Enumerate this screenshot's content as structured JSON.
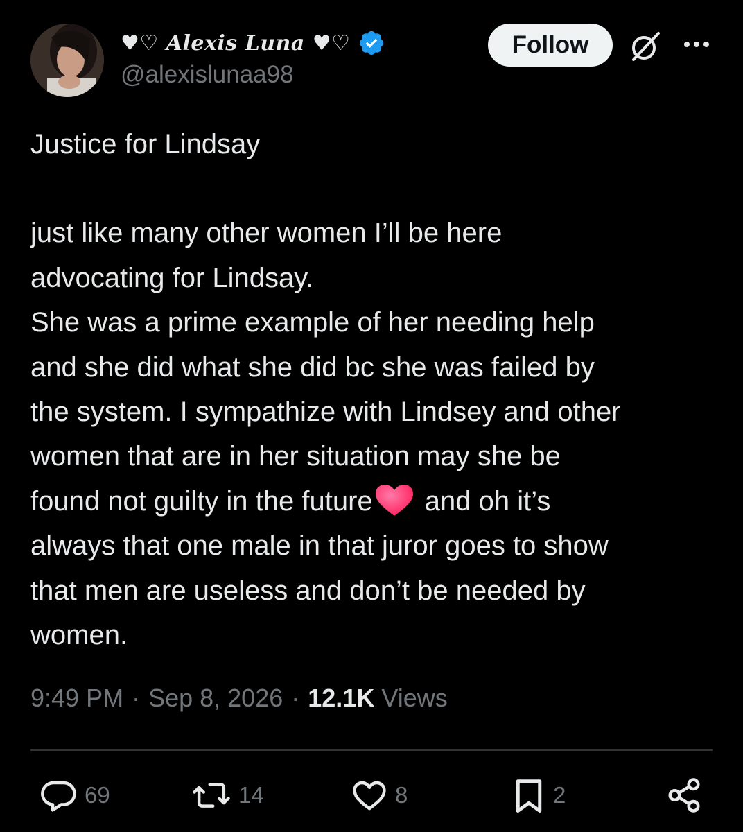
{
  "author": {
    "display_name": "♥♡ Alexis Luna ♥♡",
    "handle": "@alexislunaa98",
    "verified_icon": "verified-badge-icon",
    "verified_color": "#1d9bf0"
  },
  "header": {
    "follow_label": "Follow",
    "grok_icon": "grok-icon",
    "more_icon": "more-options-icon"
  },
  "tweet": {
    "title_line": "Justice for Lindsay",
    "lines": [
      "just like many other women I’ll be here",
      "advocating for Lindsay.",
      "She was a prime example of her needing help",
      "and she did what she did bc she  was failed by",
      "the system. I sympathize with Lindsey and other",
      "women that are in her situation may she be"
    ],
    "line_with_emoji_before": "found not guilty in the future",
    "emoji": "❤️",
    "line_with_emoji_after": " and oh it’s",
    "lines_after": [
      "always that one male in that juror goes to show",
      "that men are useless and don’t be needed by",
      "women."
    ]
  },
  "meta": {
    "time": "9:49 PM",
    "date": "Sep 8, 2026",
    "separator": "·",
    "views_count": "12.1K",
    "views_label": "Views"
  },
  "actions": {
    "reply_count": "69",
    "retweet_count": "14",
    "like_count": "8",
    "bookmark_count": "2",
    "reply_icon": "reply-icon",
    "retweet_icon": "retweet-icon",
    "like_icon": "heart-icon",
    "bookmark_icon": "bookmark-icon",
    "share_icon": "share-icon"
  },
  "colors": {
    "background": "#000000",
    "text_primary": "#e7e9ea",
    "text_secondary": "#71767b",
    "divider": "#2f3336",
    "follow_button_bg": "#eff3f4"
  }
}
